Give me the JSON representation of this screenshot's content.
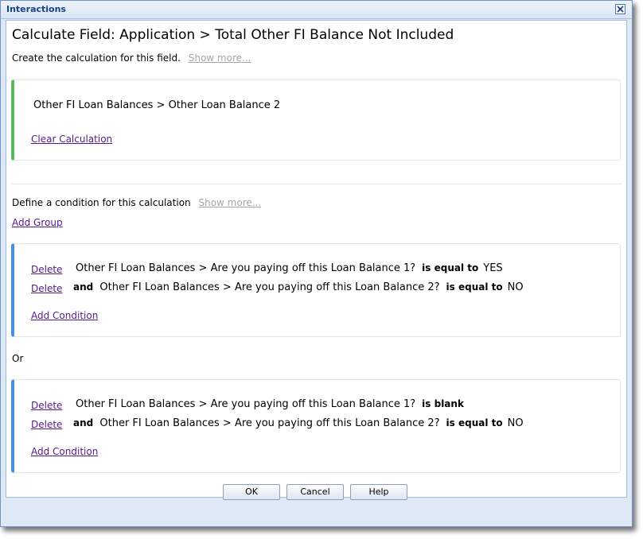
{
  "window": {
    "title": "Interactions"
  },
  "heading": "Calculate Field: Application > Total Other FI Balance Not Included",
  "subline": {
    "text": "Create the calculation for this field.",
    "show_more": "Show more..."
  },
  "calculation": {
    "expression": "Other FI Loan Balances > Other Loan Balance 2",
    "clear_label": "Clear Calculation"
  },
  "condition_section": {
    "text": "Define a condition for this calculation",
    "show_more": "Show more...",
    "add_group": "Add Group",
    "or_label": "Or"
  },
  "groups": [
    {
      "rows": [
        {
          "delete": "Delete",
          "connector": "",
          "field": "Other FI Loan Balances > Are you paying off this Loan Balance 1?",
          "operator": "is equal to",
          "value": "YES"
        },
        {
          "delete": "Delete",
          "connector": "and",
          "field": "Other FI Loan Balances > Are you paying off this Loan Balance 2?",
          "operator": "is equal to",
          "value": "NO"
        }
      ],
      "add_condition": "Add Condition"
    },
    {
      "rows": [
        {
          "delete": "Delete",
          "connector": "",
          "field": "Other FI Loan Balances > Are you paying off this Loan Balance 1?",
          "operator": "is blank",
          "value": ""
        },
        {
          "delete": "Delete",
          "connector": "and",
          "field": "Other FI Loan Balances > Are you paying off this Loan Balance 2?",
          "operator": "is equal to",
          "value": "NO"
        }
      ],
      "add_condition": "Add Condition"
    }
  ],
  "buttons": {
    "ok": "OK",
    "cancel": "Cancel",
    "help": "Help"
  },
  "colors": {
    "calc_accent": "#5cb85c",
    "group_accent": "#4a90d9",
    "link": "#551a8b",
    "title": "#15428b"
  },
  "icons": {
    "close": "close-icon"
  }
}
